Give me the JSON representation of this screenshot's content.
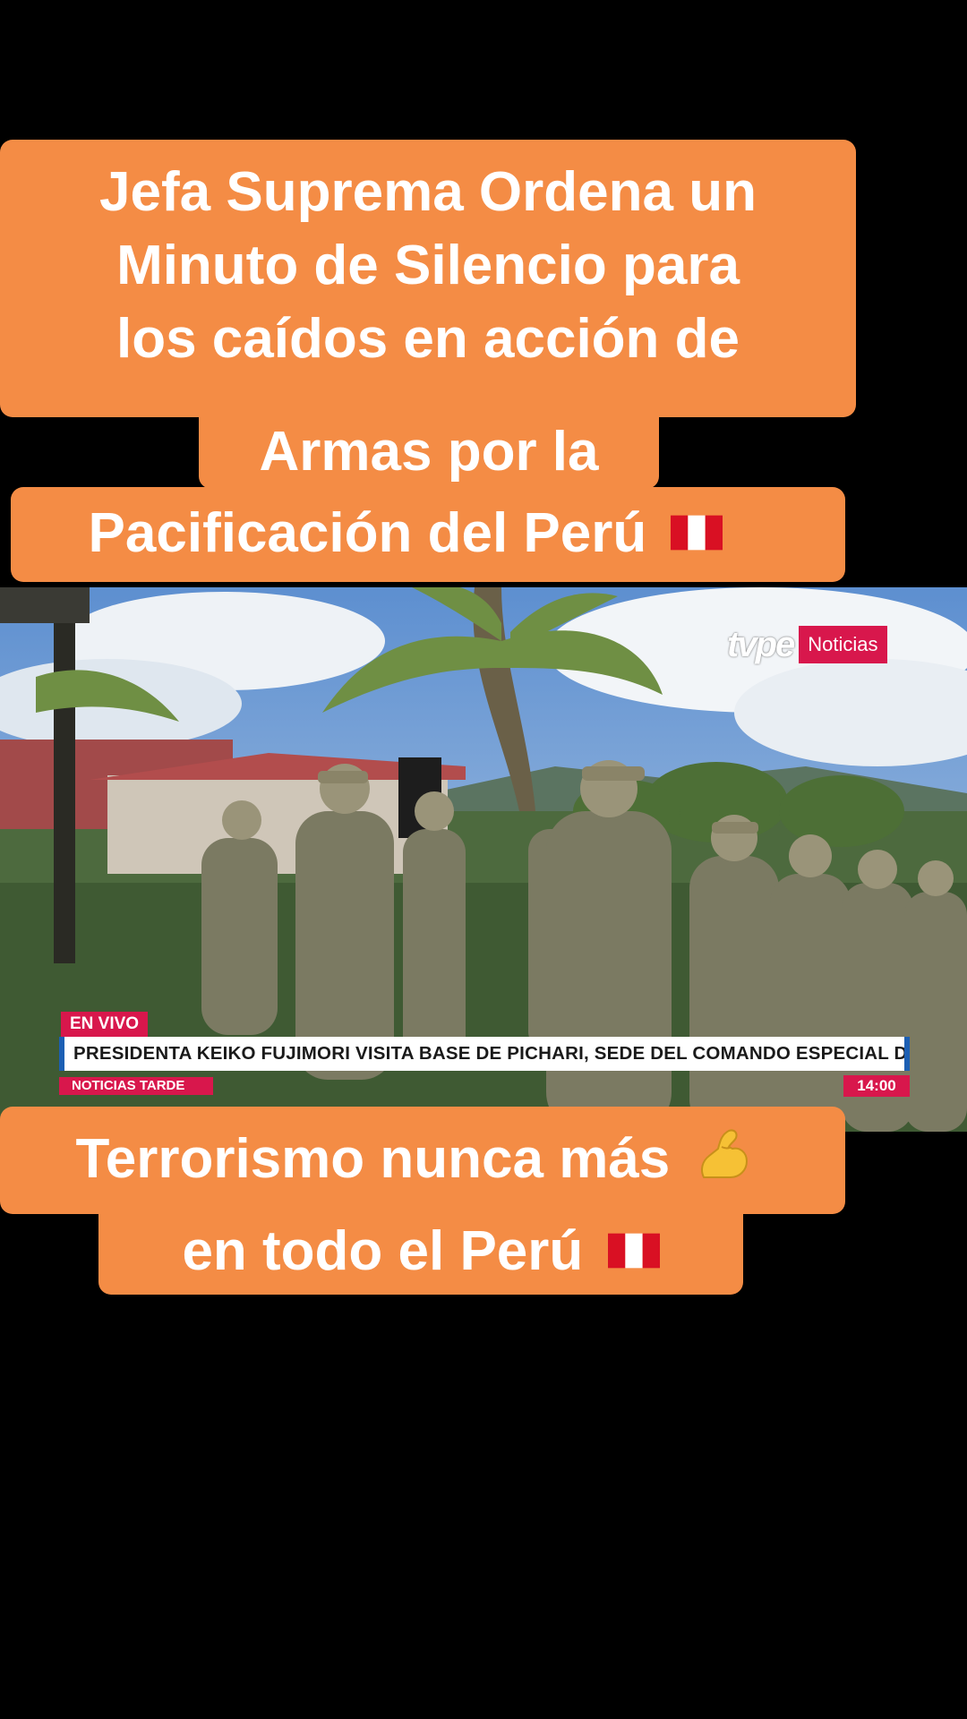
{
  "captions": {
    "top": [
      "Jefa Suprema Ordena un",
      "Minuto de Silencio para",
      "los caídos en acción de"
    ],
    "middle": "Armas por la",
    "third": "Pacificación del Perú",
    "bottom1": "Terrorismo nunca más",
    "bottom2": "en todo el Perú"
  },
  "icons": {
    "flag": "peru-flag-icon",
    "arm": "flexed-biceps-icon"
  },
  "video": {
    "logo_text": "tvpe",
    "logo_badge": "Noticias",
    "live_label": "EN VIVO",
    "headline": "PRESIDENTA KEIKO FUJIMORI VISITA BASE DE PICHARI, SEDE DEL COMANDO ESPECIAL DEL VRAEM",
    "program": "NOTICIAS TARDE",
    "time": "14:00"
  },
  "colors": {
    "caption_bg": "#F48C45",
    "caption_text": "#FFFFFF",
    "news_red": "#D8174C",
    "news_blue": "#1C5FB3",
    "background": "#000000"
  }
}
